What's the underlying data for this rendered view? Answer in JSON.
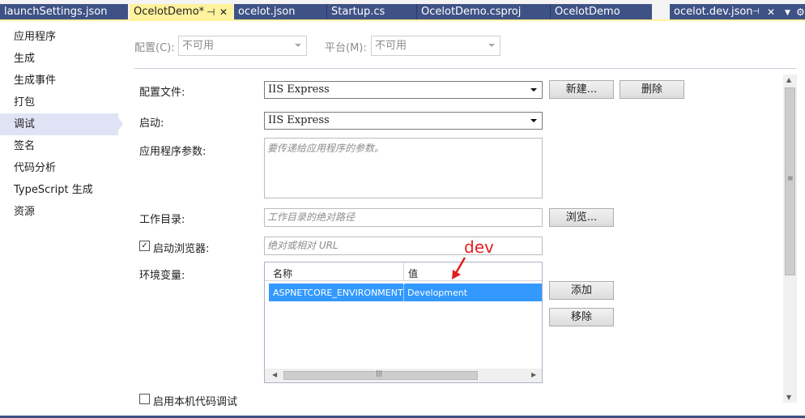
{
  "tabs": [
    {
      "label": "launchSettings.json"
    },
    {
      "label": "OcelotDemo*",
      "active": true
    },
    {
      "label": "ocelot.json"
    },
    {
      "label": "Startup.cs"
    },
    {
      "label": "OcelotDemo.csproj"
    },
    {
      "label": "OcelotDemo"
    },
    {
      "label": "ocelot.dev.json"
    }
  ],
  "nav": {
    "items": [
      "应用程序",
      "生成",
      "生成事件",
      "打包",
      "调试",
      "签名",
      "代码分析",
      "TypeScript 生成",
      "资源"
    ],
    "selected_index": 4
  },
  "config_bar": {
    "config_label": "配置(C):",
    "config_value": "不可用",
    "platform_label": "平台(M):",
    "platform_value": "不可用"
  },
  "form": {
    "profile_label": "配置文件:",
    "profile_value": "IIS Express",
    "new_button": "新建...",
    "delete_button": "删除",
    "launch_label": "启动:",
    "launch_value": "IIS Express",
    "args_label": "应用程序参数:",
    "args_placeholder": "要传递给应用程序的参数。",
    "workdir_label": "工作目录:",
    "workdir_placeholder": "工作目录的绝对路径",
    "browse_button": "浏览...",
    "launch_browser_label": "启动浏览器:",
    "launch_browser_checked": true,
    "url_placeholder": "绝对或相对 URL",
    "env_label": "环境变量:",
    "env_columns": [
      "名称",
      "值"
    ],
    "env_rows": [
      {
        "name": "ASPNETCORE_ENVIRONMENT",
        "value": "Development"
      }
    ],
    "add_button": "添加",
    "remove_button": "移除",
    "native_debug_label": "启用本机代码调试",
    "native_debug_checked": false
  },
  "annotation": {
    "text": "dev",
    "color": "#e02020"
  },
  "colors": {
    "tab_bg": "#3f5285",
    "tab_active_bg": "#fff29d",
    "nav_selected_bg": "#dfe3f5",
    "grid_selected_bg": "#3399ff"
  }
}
